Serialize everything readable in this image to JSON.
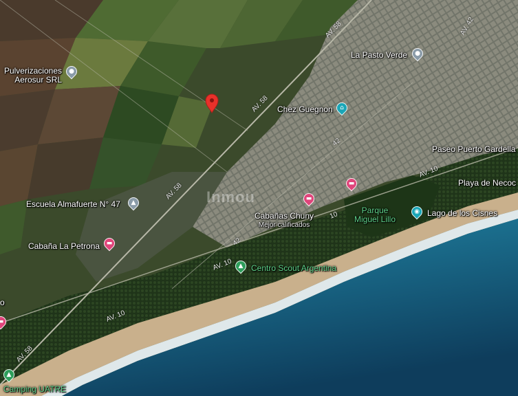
{
  "map": {
    "places": {
      "pulverizaciones": "Pulverizaciones\nAerosur SRL",
      "pasto_verde": "La Pasto Verde",
      "chez_guegnon": "Chez Guegnon",
      "paseo_puerto": "Paseo Puerto Gardella",
      "playa": "Playa de Necoc",
      "escuela": "Escuela Almafuerte N° 47",
      "cabanas_chuny": "Cabañas Chuny",
      "cabanas_sub": "Mejor calificados",
      "parque": "Parque\nMiguel Lillo",
      "lago": "Lago de los Cisnes",
      "cabana_petrona": "Cabaña La Petrona",
      "centro_scout": "Centro Scout Argentina",
      "camping": "Camping UATRE",
      "edge_left": "o"
    },
    "roads": {
      "av58": "AV. 58",
      "av10": "AV. 10",
      "av42": "AV. 42",
      "c_42": "42",
      "c_10": "10"
    },
    "watermark": "Inmou",
    "icons": {
      "pin_pulverizaciones": "grey-location-pin-icon",
      "pin_pasto_verde": "grey-location-pin-icon",
      "pin_chez_guegnon": "hotel-pin-icon",
      "pin_escuela": "school-pin-icon",
      "pin_cabanas_chuny": "lodging-pin-icon",
      "pin_lodging_2": "lodging-pin-icon",
      "pin_lago": "camera-pin-icon",
      "pin_cabana_petrona": "lodging-pin-icon",
      "pin_centro_scout": "campground-pin-icon",
      "pin_camping": "campground-pin-icon",
      "pin_left_edge": "lodging-pin-icon",
      "selected": "red-map-marker-icon"
    },
    "colors": {
      "farmland": "#3d4d2c",
      "urban": "#6e7165",
      "forest": "#1e3318",
      "beach": "#c9b08c",
      "surf": "#dfe8ea",
      "ocean_shallow": "#2b8ea8",
      "ocean_deep": "#0e3d5c",
      "pin_red": "#e8312a"
    }
  }
}
